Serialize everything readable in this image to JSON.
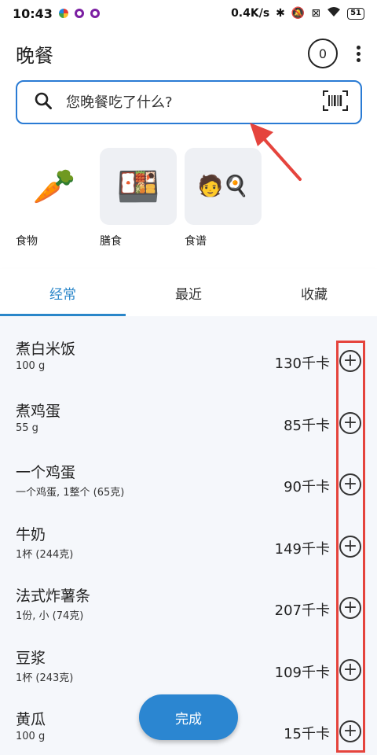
{
  "status_bar": {
    "time": "10:43",
    "speed": "0.4K/s",
    "battery": "51"
  },
  "header": {
    "title": "晚餐",
    "count": "0"
  },
  "search": {
    "placeholder": "您晚餐吃了什么?"
  },
  "categories": [
    {
      "label": "食物",
      "emoji": "🥕"
    },
    {
      "label": "膳食",
      "emoji": "🍱"
    },
    {
      "label": "食谱",
      "emoji": "🧑🍳"
    }
  ],
  "tabs": [
    {
      "label": "经常"
    },
    {
      "label": "最近"
    },
    {
      "label": "收藏"
    }
  ],
  "items": [
    {
      "name": "煮白米饭",
      "serving": "100 g",
      "calories": "130千卡"
    },
    {
      "name": "煮鸡蛋",
      "serving": "55 g",
      "calories": "85千卡"
    },
    {
      "name": "一个鸡蛋",
      "serving": "一个鸡蛋, 1整个 (65克)",
      "calories": "90千卡"
    },
    {
      "name": "牛奶",
      "serving": "1杯 (244克)",
      "calories": "149千卡"
    },
    {
      "name": "法式炸薯条",
      "serving": "1份, 小 (74克)",
      "calories": "207千卡"
    },
    {
      "name": "豆浆",
      "serving": "1杯 (243克)",
      "calories": "109千卡"
    },
    {
      "name": "黄瓜",
      "serving": "100 g",
      "calories": "15千卡"
    }
  ],
  "done_button": {
    "label": "完成"
  },
  "colors": {
    "accent": "#2a86c9",
    "highlight": "#e5443d",
    "list_bg": "#f5f7fb"
  }
}
